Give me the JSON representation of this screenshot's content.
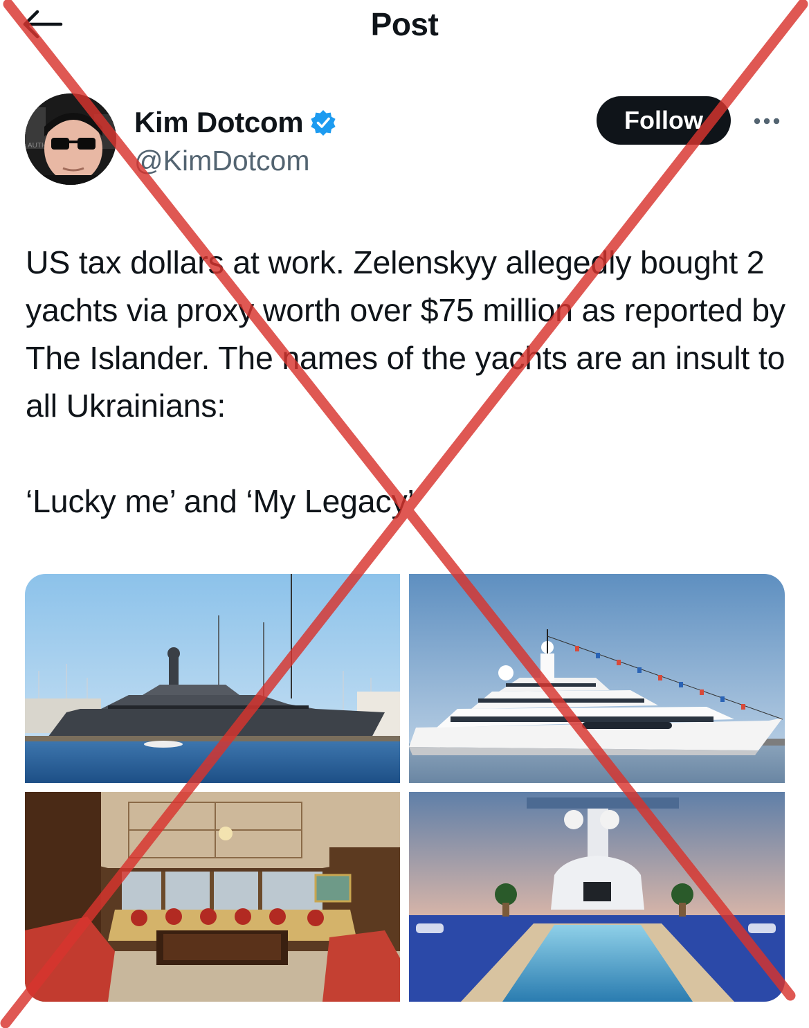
{
  "header": {
    "title": "Post",
    "back_icon": "arrow-left-icon"
  },
  "author": {
    "display_name": "Kim Dotcom",
    "handle": "@KimDotcom",
    "verified_icon": "verified-badge-icon",
    "verified_color": "#1d9bf0",
    "follow_label": "Follow",
    "more_icon": "more-horizontal-icon"
  },
  "tweet": {
    "paragraph_1": "US tax dollars at work. Zelenskyy allegedly bought 2 yachts via proxy worth over $75 million as reported by The Islander. The names of the yachts are an insult to all Ukrainians:",
    "paragraph_2": "‘Lucky me’ and ‘My Legacy’"
  },
  "media": {
    "images": [
      "dark-gray-yacht-photo",
      "white-yacht-with-flags-photo",
      "yacht-salon-interior-photo",
      "yacht-deck-pool-photo"
    ]
  },
  "overlay": {
    "type": "red-cross-mark",
    "color": "#d8342e"
  }
}
